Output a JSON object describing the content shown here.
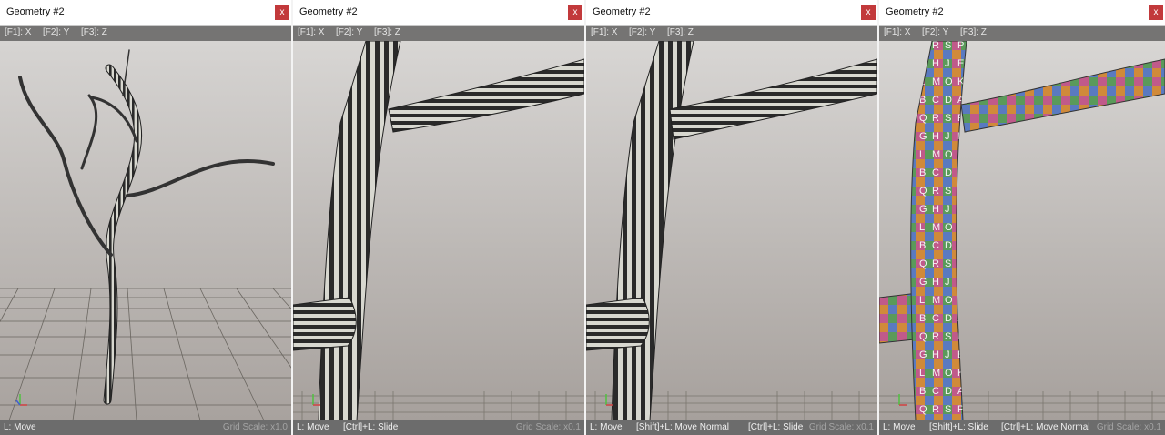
{
  "panels": [
    {
      "title": "Geometry #2",
      "close_label": "x",
      "axes": [
        "[F1]: X",
        "[F2]: Y",
        "[F3]: Z"
      ],
      "status": [
        "L: Move"
      ],
      "grid_scale": "Grid Scale: x1.0"
    },
    {
      "title": "Geometry #2",
      "close_label": "x",
      "axes": [
        "[F1]: X",
        "[F2]: Y",
        "[F3]: Z"
      ],
      "status": [
        "L: Move",
        "[Ctrl]+L: Slide"
      ],
      "grid_scale": "Grid Scale: x0.1"
    },
    {
      "title": "Geometry #2",
      "close_label": "x",
      "axes": [
        "[F1]: X",
        "[F2]: Y",
        "[F3]: Z"
      ],
      "status": [
        "L: Move",
        "[Shift]+L: Move Normal",
        "[Ctrl]+L: Slide"
      ],
      "grid_scale": "Grid Scale: x0.1"
    },
    {
      "title": "Geometry #2",
      "close_label": "x",
      "axes": [
        "[F1]: X",
        "[F2]: Y",
        "[F3]: Z"
      ],
      "status": [
        "L: Move",
        "[Shift]+L: Slide",
        "[Ctrl]+L: Move Normal"
      ],
      "grid_scale": "Grid Scale: x0.1"
    }
  ],
  "colors": {
    "close_button": "#c2393b",
    "stripe_dark": "#2a2a2a",
    "stripe_light": "#d8d8d0"
  },
  "texture_letters": [
    "Q",
    "R",
    "S",
    "P",
    "G",
    "H",
    "J",
    "E",
    "L",
    "M",
    "O",
    "K",
    "B",
    "C",
    "D",
    "A"
  ]
}
